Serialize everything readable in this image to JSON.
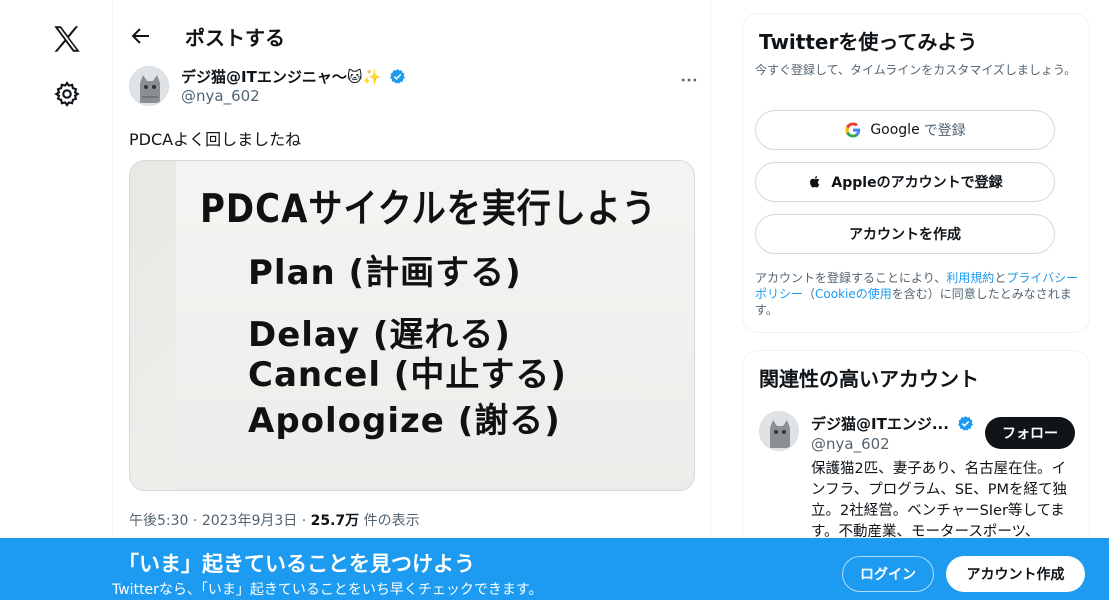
{
  "nav": {
    "logo_icon": "x-logo-icon",
    "settings_icon": "gear-icon"
  },
  "header": {
    "title": "ポストする",
    "back_icon": "arrow-left-icon"
  },
  "post": {
    "author_name": "デジ猫@ITエンジニャ〜🐱✨",
    "author_handle": "@nya_602",
    "text": "PDCAよく回しましたね",
    "image_text": {
      "line1": "PDCAサイクルを実行しよう",
      "line2": "Plan (計画する)",
      "line3": "Delay (遅れる)",
      "line4": "Cancel (中止する)",
      "line5": "Apologize (謝る)"
    },
    "time": "午後5:30",
    "date": "2023年9月3日",
    "views_count": "25.7万",
    "views_label": "件の表示",
    "separator": " · "
  },
  "signup_card": {
    "title": "Twitterを使ってみよう",
    "subtitle": "今すぐ登録して、タイムラインをカスタマイズしましょう。",
    "google_label": "Google",
    "google_suffix": "で登録",
    "apple_label": "Appleのアカウントで登録",
    "create_label": "アカウントを作成",
    "terms_prefix": "アカウントを登録することにより、",
    "terms_link1": "利用規約",
    "terms_and": "と",
    "terms_link2": "プライバシーポリシー",
    "terms_paren_open": "（",
    "terms_link3": "Cookieの使用",
    "terms_paren_rest": "を含む）に同意したとみなされます。"
  },
  "related": {
    "title": "関連性の高いアカウント",
    "name": "デジ猫@ITエンジ...",
    "handle": "@nya_602",
    "follow_label": "フォロー",
    "bio": "保護猫2匹、妻子あり、名古屋在住。インフラ、プログラム、SE、PMを経て独立。2社経営。ベンチャーSIer等してます。不動産業、モータースポーツ、"
  },
  "banner": {
    "title": "「いま」起きていることを見つけよう",
    "subtitle": "Twitterなら、「いま」起きていることをいち早くチェックできます。",
    "login_label": "ログイン",
    "signup_label": "アカウント作成"
  },
  "colors": {
    "accent": "#1d9bf0",
    "text": "#0f1419",
    "muted": "#536471"
  }
}
